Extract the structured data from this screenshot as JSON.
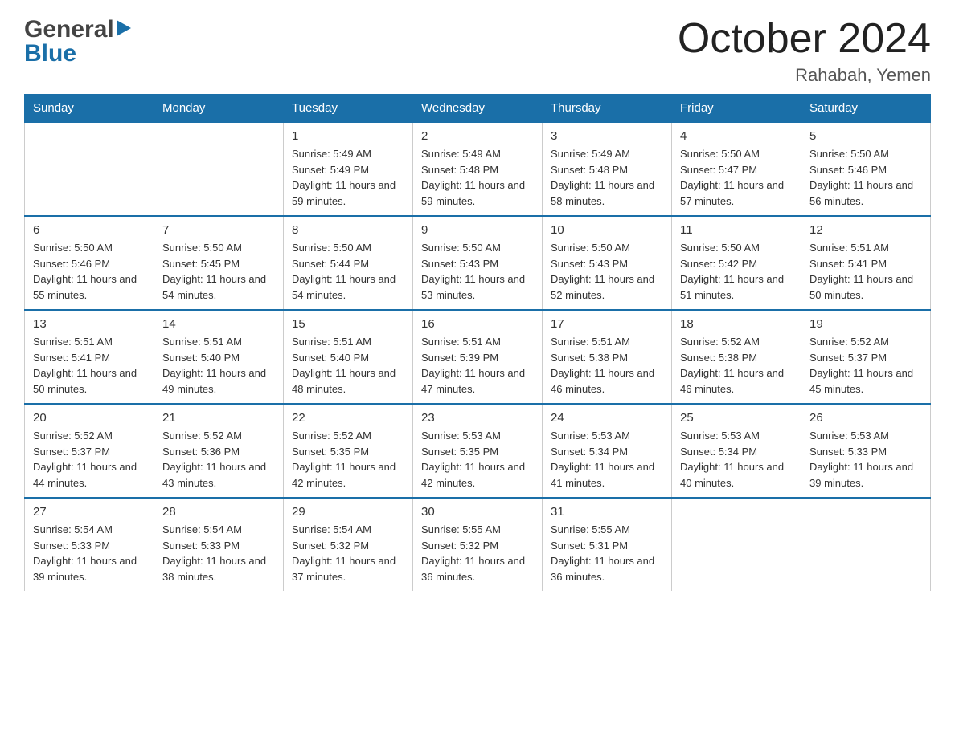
{
  "header": {
    "logo_general": "General",
    "logo_blue": "Blue",
    "month_title": "October 2024",
    "location": "Rahabah, Yemen"
  },
  "days_of_week": [
    "Sunday",
    "Monday",
    "Tuesday",
    "Wednesday",
    "Thursday",
    "Friday",
    "Saturday"
  ],
  "weeks": [
    [
      {
        "day": "",
        "sunrise": "",
        "sunset": "",
        "daylight": ""
      },
      {
        "day": "",
        "sunrise": "",
        "sunset": "",
        "daylight": ""
      },
      {
        "day": "1",
        "sunrise": "Sunrise: 5:49 AM",
        "sunset": "Sunset: 5:49 PM",
        "daylight": "Daylight: 11 hours and 59 minutes."
      },
      {
        "day": "2",
        "sunrise": "Sunrise: 5:49 AM",
        "sunset": "Sunset: 5:48 PM",
        "daylight": "Daylight: 11 hours and 59 minutes."
      },
      {
        "day": "3",
        "sunrise": "Sunrise: 5:49 AM",
        "sunset": "Sunset: 5:48 PM",
        "daylight": "Daylight: 11 hours and 58 minutes."
      },
      {
        "day": "4",
        "sunrise": "Sunrise: 5:50 AM",
        "sunset": "Sunset: 5:47 PM",
        "daylight": "Daylight: 11 hours and 57 minutes."
      },
      {
        "day": "5",
        "sunrise": "Sunrise: 5:50 AM",
        "sunset": "Sunset: 5:46 PM",
        "daylight": "Daylight: 11 hours and 56 minutes."
      }
    ],
    [
      {
        "day": "6",
        "sunrise": "Sunrise: 5:50 AM",
        "sunset": "Sunset: 5:46 PM",
        "daylight": "Daylight: 11 hours and 55 minutes."
      },
      {
        "day": "7",
        "sunrise": "Sunrise: 5:50 AM",
        "sunset": "Sunset: 5:45 PM",
        "daylight": "Daylight: 11 hours and 54 minutes."
      },
      {
        "day": "8",
        "sunrise": "Sunrise: 5:50 AM",
        "sunset": "Sunset: 5:44 PM",
        "daylight": "Daylight: 11 hours and 54 minutes."
      },
      {
        "day": "9",
        "sunrise": "Sunrise: 5:50 AM",
        "sunset": "Sunset: 5:43 PM",
        "daylight": "Daylight: 11 hours and 53 minutes."
      },
      {
        "day": "10",
        "sunrise": "Sunrise: 5:50 AM",
        "sunset": "Sunset: 5:43 PM",
        "daylight": "Daylight: 11 hours and 52 minutes."
      },
      {
        "day": "11",
        "sunrise": "Sunrise: 5:50 AM",
        "sunset": "Sunset: 5:42 PM",
        "daylight": "Daylight: 11 hours and 51 minutes."
      },
      {
        "day": "12",
        "sunrise": "Sunrise: 5:51 AM",
        "sunset": "Sunset: 5:41 PM",
        "daylight": "Daylight: 11 hours and 50 minutes."
      }
    ],
    [
      {
        "day": "13",
        "sunrise": "Sunrise: 5:51 AM",
        "sunset": "Sunset: 5:41 PM",
        "daylight": "Daylight: 11 hours and 50 minutes."
      },
      {
        "day": "14",
        "sunrise": "Sunrise: 5:51 AM",
        "sunset": "Sunset: 5:40 PM",
        "daylight": "Daylight: 11 hours and 49 minutes."
      },
      {
        "day": "15",
        "sunrise": "Sunrise: 5:51 AM",
        "sunset": "Sunset: 5:40 PM",
        "daylight": "Daylight: 11 hours and 48 minutes."
      },
      {
        "day": "16",
        "sunrise": "Sunrise: 5:51 AM",
        "sunset": "Sunset: 5:39 PM",
        "daylight": "Daylight: 11 hours and 47 minutes."
      },
      {
        "day": "17",
        "sunrise": "Sunrise: 5:51 AM",
        "sunset": "Sunset: 5:38 PM",
        "daylight": "Daylight: 11 hours and 46 minutes."
      },
      {
        "day": "18",
        "sunrise": "Sunrise: 5:52 AM",
        "sunset": "Sunset: 5:38 PM",
        "daylight": "Daylight: 11 hours and 46 minutes."
      },
      {
        "day": "19",
        "sunrise": "Sunrise: 5:52 AM",
        "sunset": "Sunset: 5:37 PM",
        "daylight": "Daylight: 11 hours and 45 minutes."
      }
    ],
    [
      {
        "day": "20",
        "sunrise": "Sunrise: 5:52 AM",
        "sunset": "Sunset: 5:37 PM",
        "daylight": "Daylight: 11 hours and 44 minutes."
      },
      {
        "day": "21",
        "sunrise": "Sunrise: 5:52 AM",
        "sunset": "Sunset: 5:36 PM",
        "daylight": "Daylight: 11 hours and 43 minutes."
      },
      {
        "day": "22",
        "sunrise": "Sunrise: 5:52 AM",
        "sunset": "Sunset: 5:35 PM",
        "daylight": "Daylight: 11 hours and 42 minutes."
      },
      {
        "day": "23",
        "sunrise": "Sunrise: 5:53 AM",
        "sunset": "Sunset: 5:35 PM",
        "daylight": "Daylight: 11 hours and 42 minutes."
      },
      {
        "day": "24",
        "sunrise": "Sunrise: 5:53 AM",
        "sunset": "Sunset: 5:34 PM",
        "daylight": "Daylight: 11 hours and 41 minutes."
      },
      {
        "day": "25",
        "sunrise": "Sunrise: 5:53 AM",
        "sunset": "Sunset: 5:34 PM",
        "daylight": "Daylight: 11 hours and 40 minutes."
      },
      {
        "day": "26",
        "sunrise": "Sunrise: 5:53 AM",
        "sunset": "Sunset: 5:33 PM",
        "daylight": "Daylight: 11 hours and 39 minutes."
      }
    ],
    [
      {
        "day": "27",
        "sunrise": "Sunrise: 5:54 AM",
        "sunset": "Sunset: 5:33 PM",
        "daylight": "Daylight: 11 hours and 39 minutes."
      },
      {
        "day": "28",
        "sunrise": "Sunrise: 5:54 AM",
        "sunset": "Sunset: 5:33 PM",
        "daylight": "Daylight: 11 hours and 38 minutes."
      },
      {
        "day": "29",
        "sunrise": "Sunrise: 5:54 AM",
        "sunset": "Sunset: 5:32 PM",
        "daylight": "Daylight: 11 hours and 37 minutes."
      },
      {
        "day": "30",
        "sunrise": "Sunrise: 5:55 AM",
        "sunset": "Sunset: 5:32 PM",
        "daylight": "Daylight: 11 hours and 36 minutes."
      },
      {
        "day": "31",
        "sunrise": "Sunrise: 5:55 AM",
        "sunset": "Sunset: 5:31 PM",
        "daylight": "Daylight: 11 hours and 36 minutes."
      },
      {
        "day": "",
        "sunrise": "",
        "sunset": "",
        "daylight": ""
      },
      {
        "day": "",
        "sunrise": "",
        "sunset": "",
        "daylight": ""
      }
    ]
  ]
}
